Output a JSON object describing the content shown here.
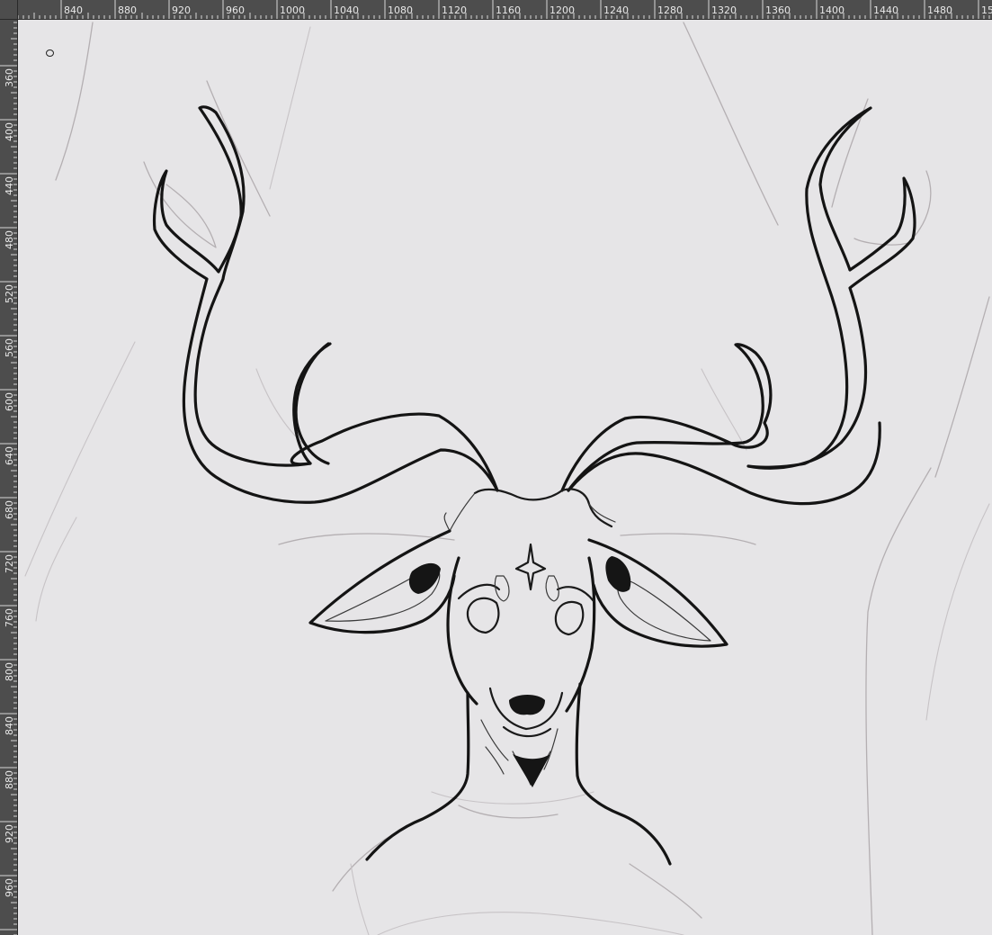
{
  "rulers": {
    "horizontal_labels": [
      "840",
      "880",
      "920",
      "960",
      "1000",
      "1040",
      "1080",
      "1120",
      "1160",
      "1200",
      "1240",
      "1280",
      "1320",
      "1360",
      "1400",
      "1440",
      "1480",
      "15"
    ],
    "vertical_labels": [
      "360",
      "400",
      "440",
      "480",
      "520",
      "560",
      "600",
      "640",
      "680",
      "720",
      "760",
      "800",
      "840",
      "880",
      "920",
      "960"
    ]
  },
  "canvas": {
    "artwork": "deer-head-lineart",
    "background_color": "#e6e5e7",
    "ink_color": "#141414",
    "sketch_color": "#b4afb2"
  },
  "tool": {
    "cursor": "brush-cursor-icon"
  },
  "colors": {
    "ruler_bg": "#4d4d4d",
    "ruler_text": "#e8e8e8"
  }
}
